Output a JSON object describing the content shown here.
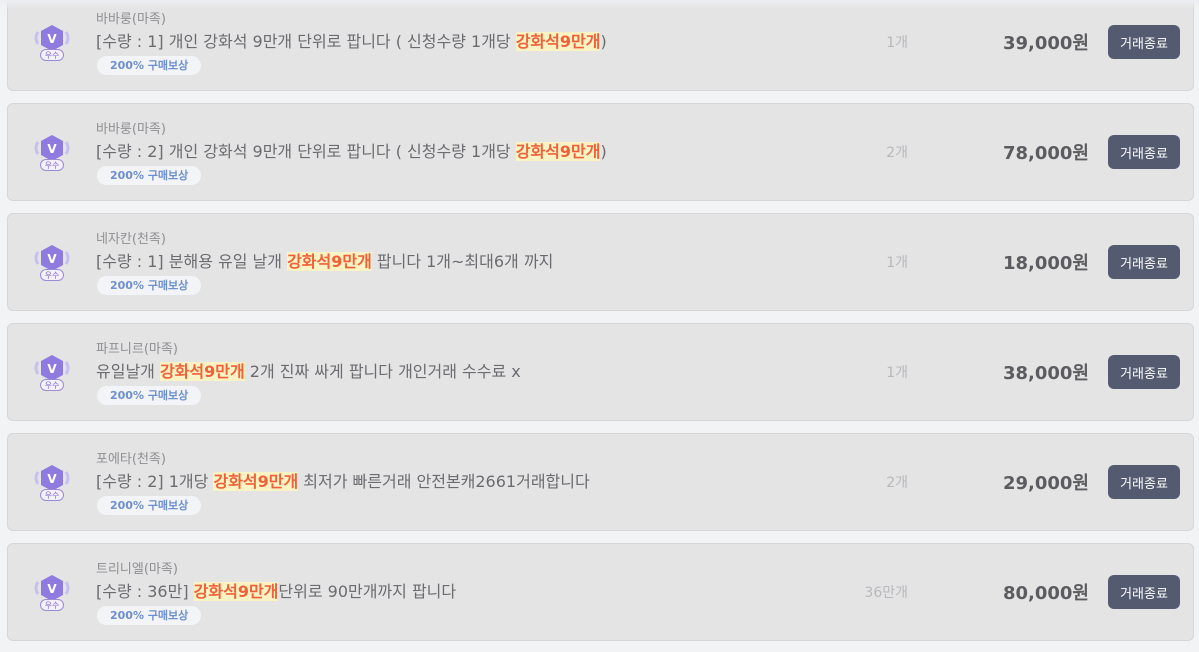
{
  "listings": [
    {
      "grade": "V",
      "grade_label": "우수",
      "seller": "바바룽(마족)",
      "title_before": "[수량 : 1] 개인 강화석 9만개 단위로 팝니다 ( 신청수량 1개당 ",
      "title_highlight": "강화석9만개",
      "title_after": ")",
      "reward": "200% 구매보상",
      "quantity": "1개",
      "price": "39,000원",
      "button": "거래종료"
    },
    {
      "grade": "V",
      "grade_label": "우수",
      "seller": "바바룽(마족)",
      "title_before": "[수량 : 2] 개인 강화석 9만개 단위로 팝니다 ( 신청수량 1개당 ",
      "title_highlight": "강화석9만개",
      "title_after": ")",
      "reward": "200% 구매보상",
      "quantity": "2개",
      "price": "78,000원",
      "button": "거래종료"
    },
    {
      "grade": "V",
      "grade_label": "우수",
      "seller": "네자칸(천족)",
      "title_before": "[수량 : 1] 분해용 유일 날개 ",
      "title_highlight": "강화석9만개",
      "title_after": " 팝니다 1개~최대6개 까지",
      "reward": "200% 구매보상",
      "quantity": "1개",
      "price": "18,000원",
      "button": "거래종료"
    },
    {
      "grade": "V",
      "grade_label": "우수",
      "seller": "파프니르(마족)",
      "title_before": "유일날개 ",
      "title_highlight": "강화석9만개",
      "title_after": " 2개 진짜 싸게 팝니다 개인거래 수수료 x",
      "reward": "200% 구매보상",
      "quantity": "1개",
      "price": "38,000원",
      "button": "거래종료"
    },
    {
      "grade": "V",
      "grade_label": "우수",
      "seller": "포에타(천족)",
      "title_before": "[수량 : 2] 1개당 ",
      "title_highlight": "강화석9만개",
      "title_after": " 최저가 빠른거래 안전본캐2661거래합니다",
      "reward": "200% 구매보상",
      "quantity": "2개",
      "price": "29,000원",
      "button": "거래종료"
    },
    {
      "grade": "V",
      "grade_label": "우수",
      "seller": "트리니엘(마족)",
      "title_before": "[수량 : 36만] ",
      "title_highlight": "강화석9만개",
      "title_after": "단위로 90만개까지 팝니다",
      "reward": "200% 구매보상",
      "quantity": "36만개",
      "price": "80,000원",
      "button": "거래종료"
    }
  ],
  "colors": {
    "highlight_text": "#f0613a",
    "highlight_bg": "#fbf3c3",
    "button_bg": "#545a70",
    "badge_purple": "#8f7be0"
  }
}
